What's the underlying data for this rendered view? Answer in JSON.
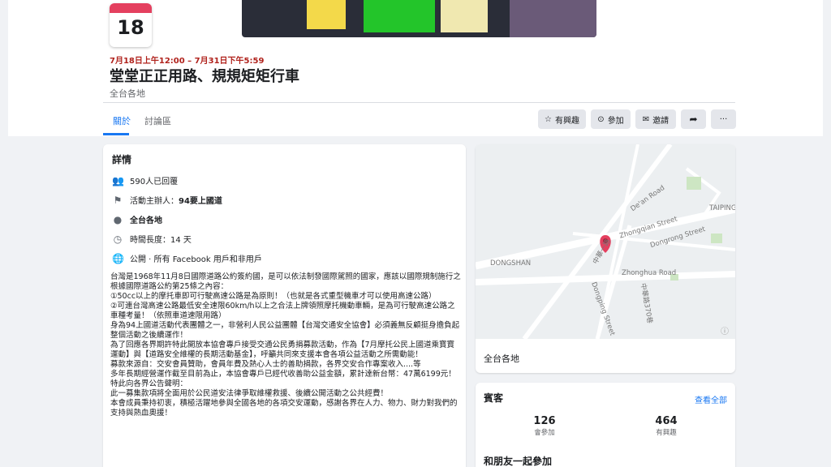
{
  "event": {
    "day": "18日",
    "when": "7月18日上午12:00 – 7月31日下午5:59",
    "title": "堂堂正正用路、規規矩矩行車",
    "location": "全台各地"
  },
  "tabs": [
    "關於",
    "討論區"
  ],
  "actions": {
    "interested": "有興趣",
    "going": "參加",
    "invite": "邀請"
  },
  "details": {
    "heading": "詳情",
    "responses": "590人已回覆",
    "host_prefix": "活動主辦人：",
    "host": "94要上國道",
    "place": "全台各地",
    "duration": "時間長度：14 天",
    "privacy": "公開 · 所有 Facebook 用戶和非用戶",
    "description": "台灣是1968年11月8日國際道路公約簽約國，是可以依法制發國際駕照的國家，應該以國際規制施行之\n根據國際道路公約第25條之內容：\n①50cc以上的摩托車即可行駛高速公路是為原則！（也就是各式重型機車才可以使用高速公路）\n②可連台灣高速公路最低安全速限60km/h以上之合法上牌領照摩托機動車輛，是為可行駛高速公路之車種考量！（依照車道速限用路）\n身為94上國道活動代表團體之一，非營利人民公益團體【台灣交通安全協會】必須義無反顧挺身擔負起整個活動之後續運作！\n為了回應各界期許特此開放本協會專戶接受交通公民勇捐募款活動，作為【7月摩托公民上國道乘寶寶運動】與【道路安全維權的長期活動基金】，呼籲共同來支援本會各項公益活動之所需動能！\n募款來源自：交安會員贊助，會員年費及熱心人士的善助捐款，各界交安合作專案收入....等\n多年長期經營運作截至目前為止，本協會專戶已經代收善助公益金額，累計達新台幣：47萬6199元！特此向各界公告聲明：\n此一募集款項將全面用於公民道安法律爭取維權救援、後續公開活動之公共經費！\n本會成員秉持初衷，積極活躍地參與全國各地的各項交安運動，感謝各界在人力、物力、財力對我們的支持與熱血奧援！"
  },
  "map": {
    "labels": [
      "DONGSHAN",
      "TAIPING",
      "De'an Road",
      "Zhongqian Street",
      "Dongrong Street",
      "Zhonghua Road",
      "Dongping Street",
      "中華路370巷",
      "中華一路"
    ],
    "caption": "全台各地"
  },
  "guests": {
    "heading": "賓客",
    "see_all": "查看全部",
    "going_count": "126",
    "going_label": "會參加",
    "interested_count": "464",
    "interested_label": "有興趣",
    "friends_heading": "和朋友一起參加"
  },
  "colors": {
    "accent": "#1877f2",
    "date_red": "#b0221c",
    "pin": "#e4405f"
  }
}
